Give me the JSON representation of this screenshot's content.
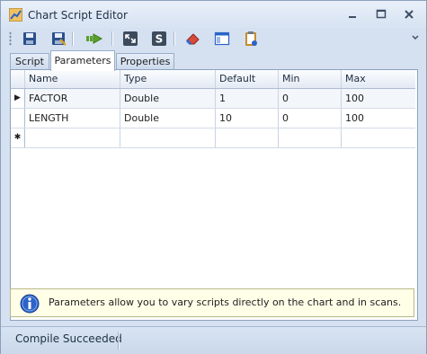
{
  "window": {
    "title": "Chart Script Editor"
  },
  "toolbar": {
    "buttons": [
      "save-icon",
      "save-as-icon",
      "run-icon",
      "minimize-script-icon",
      "script-icon",
      "eraser-icon",
      "layout-icon",
      "clipboard-icon"
    ]
  },
  "tabs": [
    {
      "label": "Script",
      "active": false
    },
    {
      "label": "Parameters",
      "active": true
    },
    {
      "label": "Properties",
      "active": false
    }
  ],
  "grid": {
    "columns": [
      "Name",
      "Type",
      "Default",
      "Min",
      "Max"
    ],
    "rows": [
      {
        "indicator": "▶",
        "cells": [
          "FACTOR",
          "Double",
          "1",
          "0",
          "100"
        ]
      },
      {
        "indicator": "",
        "cells": [
          "LENGTH",
          "Double",
          "10",
          "0",
          "100"
        ]
      },
      {
        "indicator": "✱",
        "cells": [
          "",
          "",
          "",
          "",
          ""
        ]
      }
    ]
  },
  "info": {
    "text": "Parameters allow you to vary scripts directly on the chart and in scans."
  },
  "status": {
    "text": "Compile Succeeded"
  },
  "colors": {
    "accent": "#2b63c9",
    "info_bg": "#ffffe8",
    "window_bg": "#d5e1f0"
  }
}
